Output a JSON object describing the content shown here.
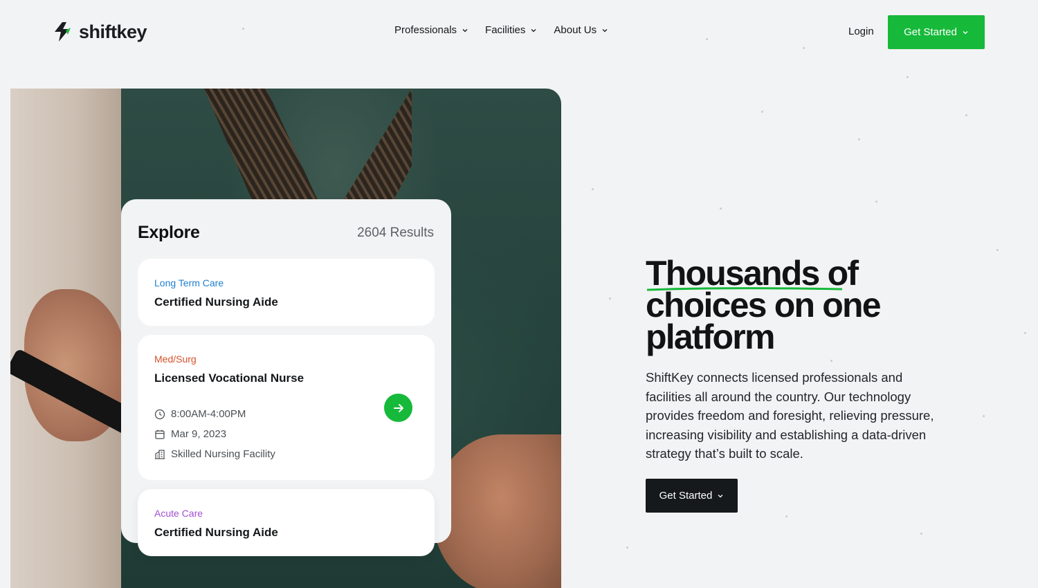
{
  "brand": {
    "name": "shiftkey",
    "accent": "#16b93a",
    "dark": "#15191c"
  },
  "nav": {
    "items": [
      {
        "label": "Professionals",
        "icon": "chevron-down-icon"
      },
      {
        "label": "Facilities",
        "icon": "chevron-down-icon"
      },
      {
        "label": "About Us",
        "icon": "chevron-down-icon"
      }
    ],
    "login": "Login",
    "get_started": "Get Started"
  },
  "explore": {
    "title": "Explore",
    "results": "2604 Results",
    "jobs": [
      {
        "category": "Long Term Care",
        "category_color": "#1f7fd0",
        "title": "Certified Nursing Aide"
      },
      {
        "category": "Med/Surg",
        "category_color": "#d4502a",
        "title": "Licensed Vocational Nurse",
        "time": "8:00AM-4:00PM",
        "date": "Mar 9, 2023",
        "facility": "Skilled Nursing Facility"
      },
      {
        "category": "Acute Care",
        "category_color": "#a24fd0",
        "title": "Certified Nursing Aide"
      }
    ]
  },
  "hero": {
    "headline_line1_a": "Thousands",
    "headline_line1_b": " of",
    "headline_line2": "choices on one",
    "headline_line3": "platform",
    "paragraph": "ShiftKey connects licensed professionals and facilities all around the country. Our technology provides freedom and foresight, relieving pressure, increasing visibility and establishing a data-driven strategy that’s built to scale.",
    "cta": "Get Started"
  }
}
